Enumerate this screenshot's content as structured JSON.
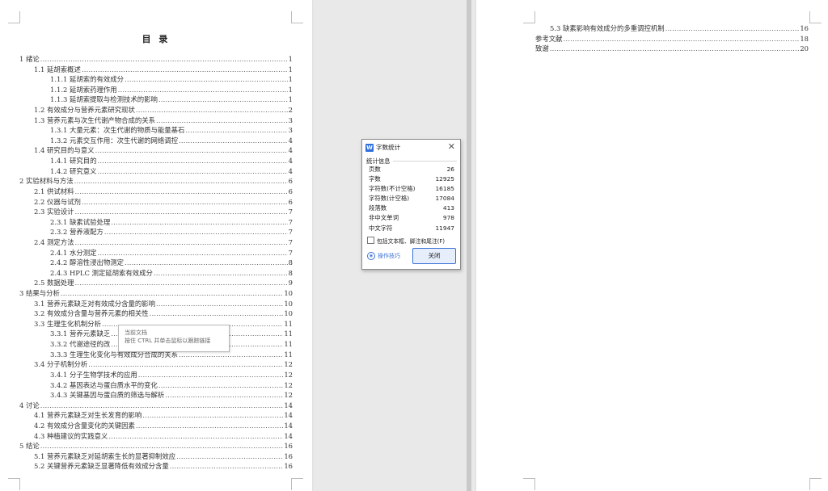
{
  "left_page": {
    "title": "目 录",
    "toc": [
      {
        "level": 1,
        "text": "1  绪论",
        "page": "1"
      },
      {
        "level": 2,
        "text": "1.1  延胡索概述",
        "page": "1"
      },
      {
        "level": 3,
        "text": "1.1.1  延胡索的有效成分",
        "page": "1"
      },
      {
        "level": 3,
        "text": "1.1.2  延胡索药理作用",
        "page": "1"
      },
      {
        "level": 3,
        "text": "1.1.3  延胡索提取与检测技术的影响",
        "page": "1"
      },
      {
        "level": 2,
        "text": "1.2  有效成分与营养元素研究现状",
        "page": "2"
      },
      {
        "level": 2,
        "text": "1.3  营养元素与次生代谢产物合成的关系",
        "page": "3"
      },
      {
        "level": 3,
        "text": "1.3.1  大量元素：次生代谢的物质与能量基石",
        "page": "3"
      },
      {
        "level": 3,
        "text": "1.3.2 元素交互作用：次生代谢的网络调控",
        "page": "4"
      },
      {
        "level": 2,
        "text": "1.4  研究目的与意义",
        "page": "4"
      },
      {
        "level": 3,
        "text": "1.4.1  研究目的",
        "page": "4"
      },
      {
        "level": 3,
        "text": "1.4.2  研究意义",
        "page": "4"
      },
      {
        "level": 1,
        "text": "2  实验材料与方法",
        "page": "6"
      },
      {
        "level": 2,
        "text": "2.1  供试材料",
        "page": "6"
      },
      {
        "level": 2,
        "text": "2.2  仪器与试剂",
        "page": "6"
      },
      {
        "level": 2,
        "text": "2.3  实验设计",
        "page": "7"
      },
      {
        "level": 3,
        "text": "2.3.1  缺素试验处理",
        "page": "7"
      },
      {
        "level": 3,
        "text": "2.3.2  营养液配方",
        "page": "7"
      },
      {
        "level": 2,
        "text": "2.4  测定方法",
        "page": "7"
      },
      {
        "level": 3,
        "text": "2.4.1 水分测定",
        "page": "7"
      },
      {
        "level": 3,
        "text": "2.4.2 醇溶性浸出物测定",
        "page": "8"
      },
      {
        "level": 3,
        "text": "2.4.3 HPLC 测定延胡索有效成分",
        "page": "8"
      },
      {
        "level": 2,
        "text": "2.5  数据处理",
        "page": "9"
      },
      {
        "level": 1,
        "text": "3  结果与分析",
        "page": "10"
      },
      {
        "level": 2,
        "text": "3.1  营养元素缺乏对有效成分含量的影响",
        "page": "10"
      },
      {
        "level": 2,
        "text": "3.2 有效成分含量与营养元素的相关性",
        "page": "10"
      },
      {
        "level": 2,
        "text": "3.3  生理生化机制分析",
        "page": "11"
      },
      {
        "level": 3,
        "text": "3.3.1 营养元素缺乏",
        "page": "11"
      },
      {
        "level": 3,
        "text": "3.3.2 代谢途径的改",
        "page": "11"
      },
      {
        "level": 3,
        "text": "3.3.3 生理生化变化与有效成分合成的关系",
        "page": "11"
      },
      {
        "level": 2,
        "text": "3.4  分子机制分析",
        "page": "12"
      },
      {
        "level": 3,
        "text": "3.4.1 分子生物学技术的应用",
        "page": "12"
      },
      {
        "level": 3,
        "text": "3.4.2 基因表达与蛋白质水平的变化",
        "page": "12"
      },
      {
        "level": 3,
        "text": "3.4.3 关键基因与蛋白质的筛选与解析",
        "page": "12"
      },
      {
        "level": 1,
        "text": "4  讨论",
        "page": "14"
      },
      {
        "level": 2,
        "text": "4.1  营养元素缺乏对生长发育的影响",
        "page": "14"
      },
      {
        "level": 2,
        "text": "4.2  有效成分含量变化的关键因素",
        "page": "14"
      },
      {
        "level": 2,
        "text": "4.3  种植建议的实践意义",
        "page": "14"
      },
      {
        "level": 1,
        "text": "5  结论",
        "page": "16"
      },
      {
        "level": 2,
        "text": "5.1  营养元素缺乏对延胡索生长的显著抑制效应",
        "page": "16"
      },
      {
        "level": 2,
        "text": "5.2  关键营养元素缺乏显著降低有效成分含量",
        "page": "16"
      }
    ]
  },
  "right_page": {
    "toc": [
      {
        "level": "indent",
        "text": "5.3  缺素影响有效成分的多重调控机制",
        "page": "16"
      },
      {
        "level": "flat",
        "text": "参考文献",
        "page": "18"
      },
      {
        "level": "flat",
        "text": "致谢",
        "page": "20"
      }
    ]
  },
  "tooltip": {
    "line1": "当前文档",
    "line2": "按住 CTRL 并单击鼠标以跟踪链接"
  },
  "word_count_dialog": {
    "app_icon": "W",
    "title": "字数统计",
    "section": "统计信息",
    "stats": [
      {
        "label": "页数",
        "value": "26"
      },
      {
        "label": "字数",
        "value": "12925"
      },
      {
        "label": "字符数(不计空格)",
        "value": "16185"
      },
      {
        "label": "字符数(计空格)",
        "value": "17084"
      },
      {
        "label": "段落数",
        "value": "413"
      },
      {
        "label": "非中文单词",
        "value": "978"
      },
      {
        "label": "中文字符",
        "value": "11947"
      }
    ],
    "checkbox_label": "包括文本框、脚注和尾注(F)",
    "checkbox_checked": false,
    "tips_label": "操作技巧",
    "close_label": "关闭",
    "accent_color": "#3b72d6"
  }
}
